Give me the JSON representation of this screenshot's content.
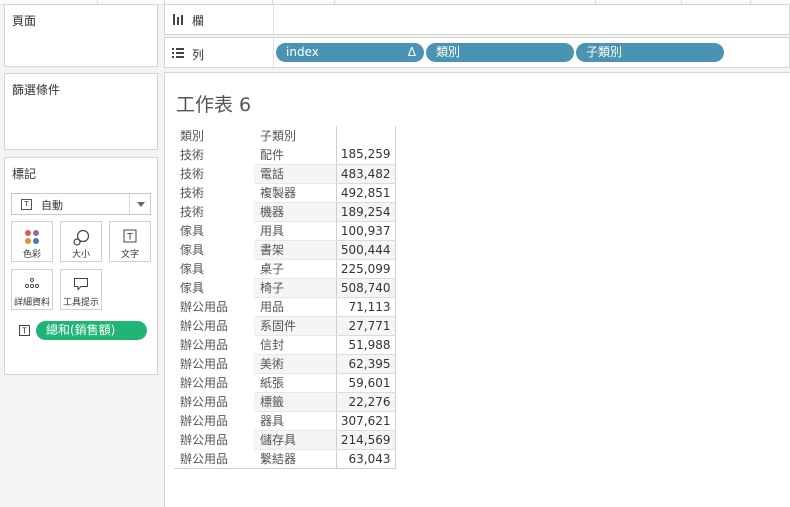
{
  "cards": {
    "pages": {
      "title": "頁面"
    },
    "filters": {
      "title": "篩選條件"
    },
    "marks": {
      "title": "標記",
      "mark_type": "自動",
      "buttons": {
        "color": "色彩",
        "size": "大小",
        "text": "文字",
        "detail": "詳細資料",
        "tooltip": "工具提示"
      },
      "text_pill": "總和(銷售額)"
    }
  },
  "shelves": {
    "columns": {
      "label": "欄",
      "pills": []
    },
    "rows": {
      "label": "列",
      "pills": [
        "index",
        "類別",
        "子類別"
      ],
      "sort_icon": "Δ"
    }
  },
  "view": {
    "title": "工作表 6",
    "headers": [
      "類別",
      "子類別",
      ""
    ],
    "rows": [
      {
        "category": "技術",
        "subcategory": "配件",
        "value": "185,259"
      },
      {
        "category": "技術",
        "subcategory": "電話",
        "value": "483,482"
      },
      {
        "category": "技術",
        "subcategory": "複製器",
        "value": "492,851"
      },
      {
        "category": "技術",
        "subcategory": "機器",
        "value": "189,254"
      },
      {
        "category": "傢具",
        "subcategory": "用具",
        "value": "100,937"
      },
      {
        "category": "傢具",
        "subcategory": "書架",
        "value": "500,444"
      },
      {
        "category": "傢具",
        "subcategory": "桌子",
        "value": "225,099"
      },
      {
        "category": "傢具",
        "subcategory": "椅子",
        "value": "508,740"
      },
      {
        "category": "辦公用品",
        "subcategory": "用品",
        "value": "71,113"
      },
      {
        "category": "辦公用品",
        "subcategory": "系固件",
        "value": "27,771"
      },
      {
        "category": "辦公用品",
        "subcategory": "信封",
        "value": "51,988"
      },
      {
        "category": "辦公用品",
        "subcategory": "美術",
        "value": "62,395"
      },
      {
        "category": "辦公用品",
        "subcategory": "紙張",
        "value": "59,601"
      },
      {
        "category": "辦公用品",
        "subcategory": "標籤",
        "value": "22,276"
      },
      {
        "category": "辦公用品",
        "subcategory": "器具",
        "value": "307,621"
      },
      {
        "category": "辦公用品",
        "subcategory": "儲存具",
        "value": "214,569"
      },
      {
        "category": "辦公用品",
        "subcategory": "繫結器",
        "value": "63,043"
      }
    ]
  },
  "colors": {
    "green_pill": "#1fb574",
    "blue_pill": "#4a93b2"
  }
}
